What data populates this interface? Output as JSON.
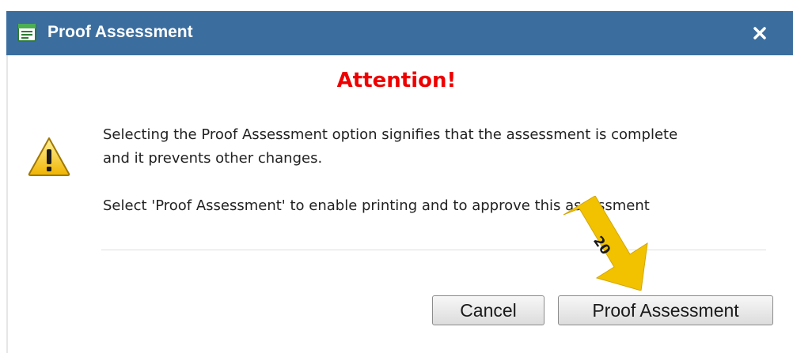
{
  "window": {
    "title": "Proof Assessment",
    "close_label": "×"
  },
  "dialog": {
    "heading": "Attention!",
    "message_line1": "Selecting the Proof Assessment option signifies that the assessment is complete",
    "message_line2": "and it prevents other changes.",
    "message_line3": "Select 'Proof Assessment' to enable printing and to approve this assessment"
  },
  "buttons": {
    "cancel_label": "Cancel",
    "proof_label": "Proof Assessment"
  },
  "annotation": {
    "step_number": "20"
  },
  "colors": {
    "titlebar": "#3b6e9f",
    "heading": "#ee0000",
    "arrow": "#f2c200"
  },
  "icons": {
    "title": "window-form-icon",
    "warning": "warning-triangle-icon",
    "close": "close-icon"
  }
}
